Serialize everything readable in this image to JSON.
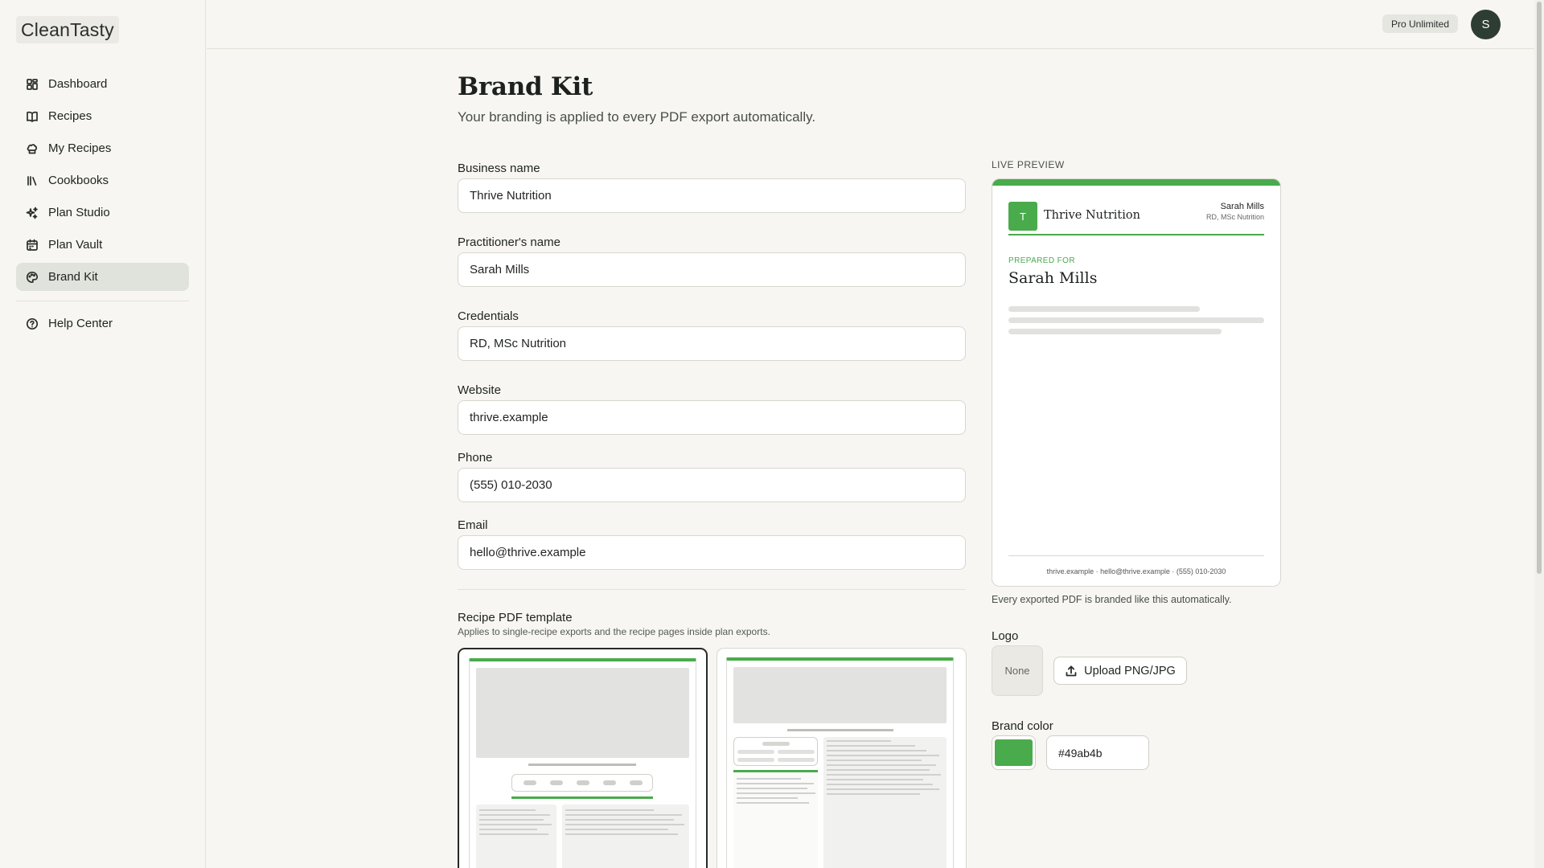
{
  "app": {
    "logo": "CleanTasty"
  },
  "sidebar": {
    "items": [
      {
        "label": "Dashboard",
        "icon": "dashboard-icon"
      },
      {
        "label": "Recipes",
        "icon": "book-icon"
      },
      {
        "label": "My Recipes",
        "icon": "chef-hat-icon"
      },
      {
        "label": "Cookbooks",
        "icon": "library-icon"
      },
      {
        "label": "Plan Studio",
        "icon": "sparkles-icon"
      },
      {
        "label": "Plan Vault",
        "icon": "calendar-icon"
      },
      {
        "label": "Brand Kit",
        "icon": "palette-icon",
        "active": true
      }
    ],
    "help": {
      "label": "Help Center",
      "icon": "help-icon"
    }
  },
  "topbar": {
    "plan_badge": "Pro Unlimited",
    "avatar_initial": "S"
  },
  "page": {
    "title": "Brand Kit",
    "subtitle": "Your branding is applied to every PDF export automatically."
  },
  "form": {
    "business_name": {
      "label": "Business name",
      "value": "Thrive Nutrition"
    },
    "practitioner_name": {
      "label": "Practitioner's name",
      "value": "Sarah Mills"
    },
    "credentials": {
      "label": "Credentials",
      "value": "RD, MSc Nutrition"
    },
    "website": {
      "label": "Website",
      "value": "thrive.example"
    },
    "phone": {
      "label": "Phone",
      "value": "(555) 010-2030"
    },
    "email": {
      "label": "Email",
      "value": "hello@thrive.example"
    }
  },
  "template": {
    "title": "Recipe PDF template",
    "subtitle": "Applies to single-recipe exports and the recipe pages inside plan exports.",
    "selected_index": 0
  },
  "preview": {
    "label": "LIVE PREVIEW",
    "logo_initial": "T",
    "business": "Thrive Nutrition",
    "practitioner": "Sarah Mills",
    "credentials": "RD, MSc Nutrition",
    "prepared_for_label": "PREPARED FOR",
    "client": "Sarah Mills",
    "footer": "thrive.example · hello@thrive.example · (555) 010-2030",
    "caption": "Every exported PDF is branded like this automatically."
  },
  "logo": {
    "label": "Logo",
    "placeholder": "None",
    "upload_label": "Upload PNG/JPG"
  },
  "brand_color": {
    "label": "Brand color",
    "hex": "#49ab4b"
  }
}
